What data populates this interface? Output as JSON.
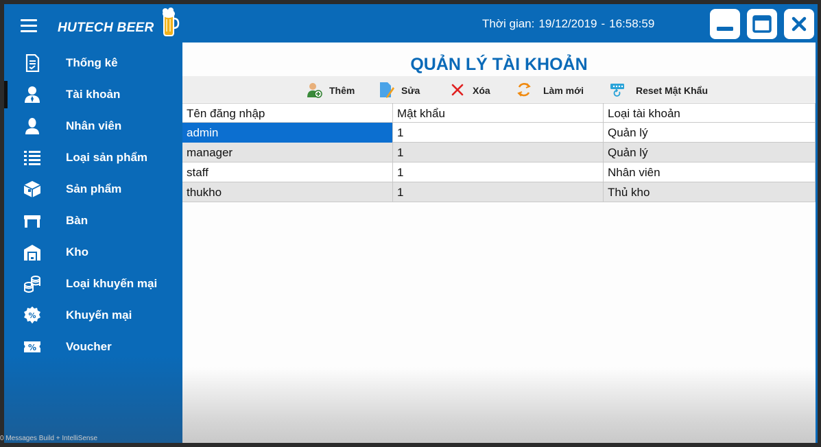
{
  "app": {
    "brand": "HUTECH BEER",
    "clock_label": "Thời gian:",
    "date": "19/12/2019",
    "separator": "-",
    "time": "16:58:59"
  },
  "sidebar": {
    "items": [
      {
        "label": "Thống kê",
        "icon": "report-icon"
      },
      {
        "label": "Tài khoản",
        "icon": "user-account-icon",
        "active": true
      },
      {
        "label": "Nhân viên",
        "icon": "employee-icon"
      },
      {
        "label": "Loại sản phẩm",
        "icon": "list-icon"
      },
      {
        "label": "Sản phẩm",
        "icon": "product-box-icon"
      },
      {
        "label": "Bàn",
        "icon": "table-icon"
      },
      {
        "label": "Kho",
        "icon": "warehouse-icon"
      },
      {
        "label": "Loại khuyến mại",
        "icon": "coins-icon"
      },
      {
        "label": "Khuyến mại",
        "icon": "discount-badge-icon"
      },
      {
        "label": "Voucher",
        "icon": "voucher-icon"
      }
    ]
  },
  "main": {
    "title": "QUẢN LÝ TÀI KHOẢN",
    "toolbar": {
      "add": "Thêm",
      "edit": "Sửa",
      "delete": "Xóa",
      "refresh": "Làm mới",
      "reset_password": "Reset Mật Khẩu"
    },
    "table": {
      "columns": [
        "Tên đăng nhập",
        "Mật khẩu",
        "Loại tài khoản"
      ],
      "rows": [
        [
          "admin",
          "1",
          "Quản lý"
        ],
        [
          "manager",
          "1",
          "Quản lý"
        ],
        [
          "staff",
          "1",
          "Nhân viên"
        ],
        [
          "thukho",
          "1",
          "Thủ kho"
        ]
      ],
      "selected_row": 0
    }
  },
  "statusbar": {
    "text": "0 Messages     Build + IntelliSense"
  },
  "colors": {
    "primary": "#0a6ab8",
    "selection": "#0c6fd0",
    "toolbar_bg": "#eeeeee"
  }
}
